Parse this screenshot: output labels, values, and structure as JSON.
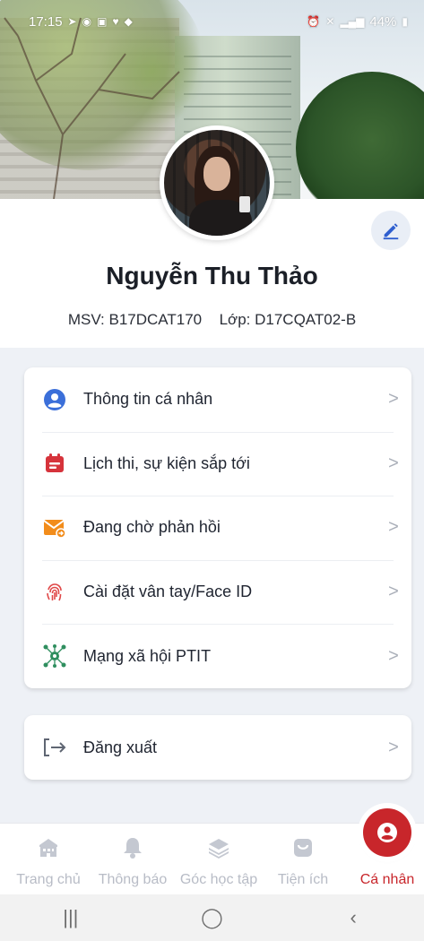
{
  "status_bar": {
    "time": "17:15",
    "battery": "44%"
  },
  "profile": {
    "name": "Nguyễn Thu Thảo",
    "msv_label": "MSV:",
    "msv_value": "B17DCAT170",
    "class_label": "Lớp:",
    "class_value": "D17CQAT02-B"
  },
  "menu": {
    "items": [
      {
        "label": "Thông tin cá nhân",
        "icon": "user-circle-icon"
      },
      {
        "label": "Lịch thi, sự kiện sắp tới",
        "icon": "calendar-icon"
      },
      {
        "label": "Đang chờ phản hồi",
        "icon": "mail-reply-icon"
      },
      {
        "label": "Cài đặt vân tay/Face ID",
        "icon": "fingerprint-icon"
      },
      {
        "label": "Mạng xã hội PTIT",
        "icon": "network-icon"
      }
    ],
    "logout_label": "Đăng xuất"
  },
  "bottom_nav": {
    "tabs": [
      {
        "label": "Trang chủ",
        "icon": "home-building-icon"
      },
      {
        "label": "Thông báo",
        "icon": "bell-icon"
      },
      {
        "label": "Góc học tập",
        "icon": "layers-icon"
      },
      {
        "label": "Tiện ích",
        "icon": "bag-icon"
      },
      {
        "label": "Cá nhân",
        "icon": "user-icon"
      }
    ],
    "active_index": 4
  },
  "colors": {
    "accent": "#c8262b",
    "background": "#eef1f6",
    "icon_blue": "#3b6fd9"
  }
}
